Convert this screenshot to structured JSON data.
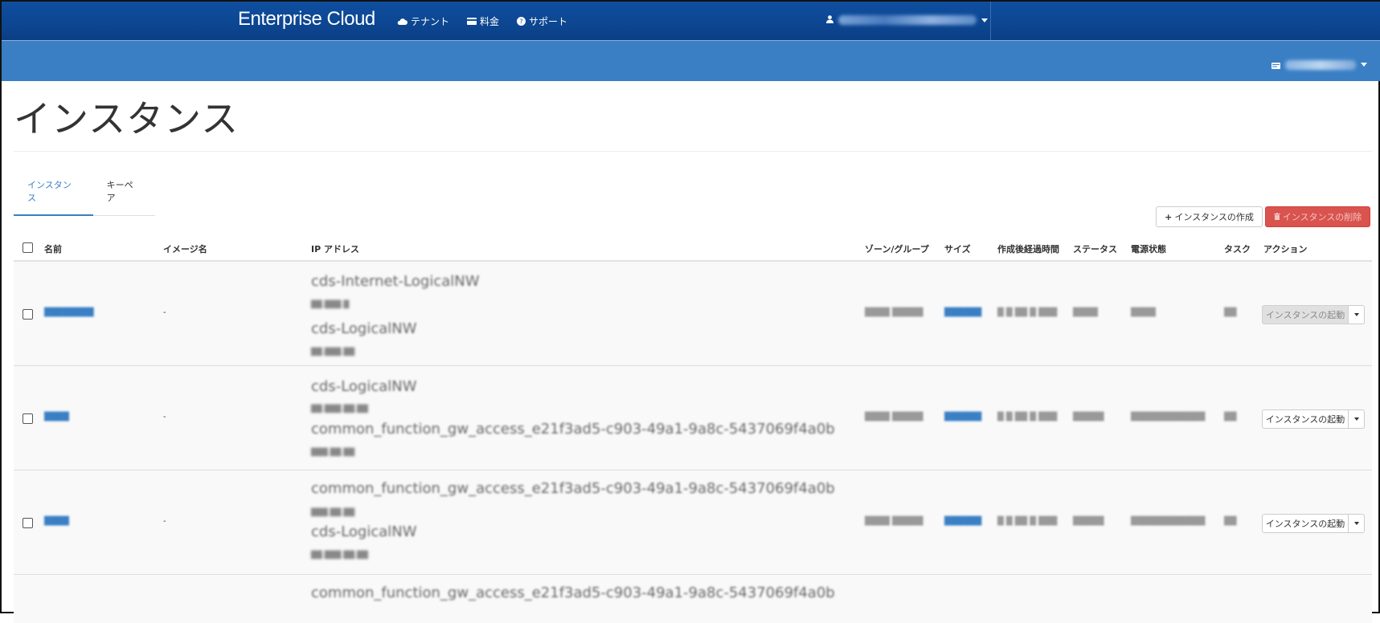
{
  "header": {
    "brand": "Enterprise Cloud",
    "nav": [
      {
        "label": "テナント",
        "icon": "cloud-icon"
      },
      {
        "label": "料金",
        "icon": "credit-card-icon"
      },
      {
        "label": "サポート",
        "icon": "question-circle-icon"
      }
    ],
    "user_icon": "user-icon"
  },
  "subbar": {
    "tenant_icon": "tenant-card-icon"
  },
  "page": {
    "title": "インスタンス"
  },
  "tabs": [
    {
      "label": "インスタンス",
      "active": true
    },
    {
      "label": "キーペア",
      "active": false
    }
  ],
  "toolbar": {
    "create_label": "インスタンスの作成",
    "delete_label": "インスタンスの削除"
  },
  "table": {
    "headers": {
      "name": "名前",
      "image": "イメージ名",
      "ip": "IP アドレス",
      "zone": "ゾーン/グループ",
      "size": "サイズ",
      "elapsed": "作成後経過時間",
      "status": "ステータス",
      "power": "電源状態",
      "task": "タスク",
      "action": "アクション"
    },
    "rows": [
      {
        "image": "-",
        "networks": [
          {
            "name": "cds-Internet-LogicalNW"
          },
          {
            "name": "cds-LogicalNW"
          }
        ],
        "action": "インスタンスの起動",
        "action_disabled": true
      },
      {
        "image": "-",
        "networks": [
          {
            "name": "cds-LogicalNW"
          },
          {
            "name": "common_function_gw_access_e21f3ad5-c903-49a1-9a8c-5437069f4a0b"
          }
        ],
        "action": "インスタンスの起動",
        "action_disabled": false
      },
      {
        "image": "-",
        "networks": [
          {
            "name": "common_function_gw_access_e21f3ad5-c903-49a1-9a8c-5437069f4a0b"
          },
          {
            "name": "cds-LogicalNW"
          }
        ],
        "action": "インスタンスの起動",
        "action_disabled": false
      },
      {
        "networks": [
          {
            "name": "common_function_gw_access_e21f3ad5-c903-49a1-9a8c-5437069f4a0b"
          }
        ]
      }
    ]
  },
  "colors": {
    "header_bg": "#0f4fa0",
    "subbar_bg": "#3a7fc4",
    "accent": "#3a7fc4",
    "danger": "#d9534f"
  }
}
